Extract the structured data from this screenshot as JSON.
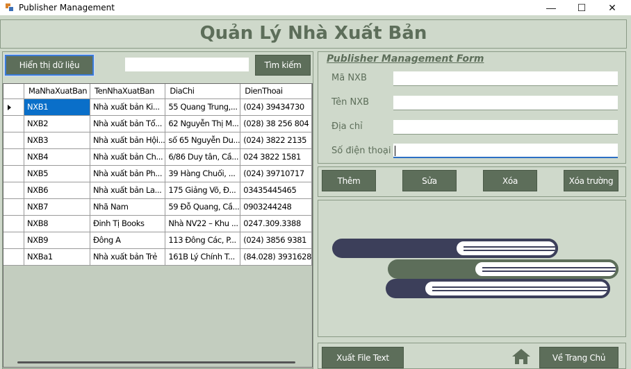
{
  "window": {
    "title": "Publisher Management",
    "controls": {
      "minimize": "—",
      "maximize": "☐",
      "close": "✕"
    }
  },
  "header": {
    "heading": "Quản Lý  Nhà Xuất Bản"
  },
  "toolbar": {
    "show_data_label": "Hiển thị dữ liệu",
    "search_value": "",
    "search_label": "Tìm kiếm"
  },
  "grid": {
    "columns": [
      "MaNhaXuatBan",
      "TenNhaXuatBan",
      "DiaChi",
      "DienThoai"
    ],
    "rows": [
      [
        "NXB1",
        "Nhà xuất bản Ki...",
        "55 Quang Trung,...",
        "(024) 39434730"
      ],
      [
        "NXB2",
        "Nhà xuất bản Tổ...",
        "62 Nguyễn Thị M...",
        "(028) 38 256 804"
      ],
      [
        "NXB3",
        "Nhà xuất bản Hội...",
        "số 65 Nguyễn Du...",
        "(024) 3822 2135"
      ],
      [
        "NXB4",
        "Nhà xuất bản Ch...",
        "6/86 Duy tân, Cầ...",
        "024 3822 1581"
      ],
      [
        "NXB5",
        "Nhà xuất bản Ph...",
        "39 Hàng Chuối, ...",
        "(024) 39710717"
      ],
      [
        "NXB6",
        "Nhà xuất bản La...",
        "175 Giảng Võ, Đ...",
        "03435445465"
      ],
      [
        "NXB7",
        "Nhã Nam",
        "59 Đỗ Quang, Cầ...",
        "0903244248"
      ],
      [
        "NXB8",
        "Đinh Tị Books",
        "Nhà NV22 – Khu ...",
        "0247.309.3388"
      ],
      [
        "NXB9",
        "Đông A",
        "113 Đông Các, P...",
        "(024) 3856 9381"
      ],
      [
        "NXBa1",
        "Nhà xuất bản Trẻ",
        "161B Lý Chính T...",
        "(84.028) 3931628"
      ]
    ],
    "selected_row": 0
  },
  "publisher_form": {
    "title": "Publisher Management Form",
    "fields": [
      {
        "label": "Mã NXB",
        "value": ""
      },
      {
        "label": "Tên NXB",
        "value": ""
      },
      {
        "label": "Địa chỉ",
        "value": ""
      },
      {
        "label": "Số điện thoại",
        "value": ""
      }
    ]
  },
  "actions": {
    "add": "Thêm",
    "edit": "Sửa",
    "delete": "Xóa",
    "clear": "Xóa trường"
  },
  "footer": {
    "export": "Xuất File Text",
    "home": "Về Trang Chủ"
  },
  "colors": {
    "background": "#cfd9cb",
    "accent": "#5d6e5a",
    "selection": "#0a6fc9",
    "book_dark": "#3c3f5a"
  }
}
